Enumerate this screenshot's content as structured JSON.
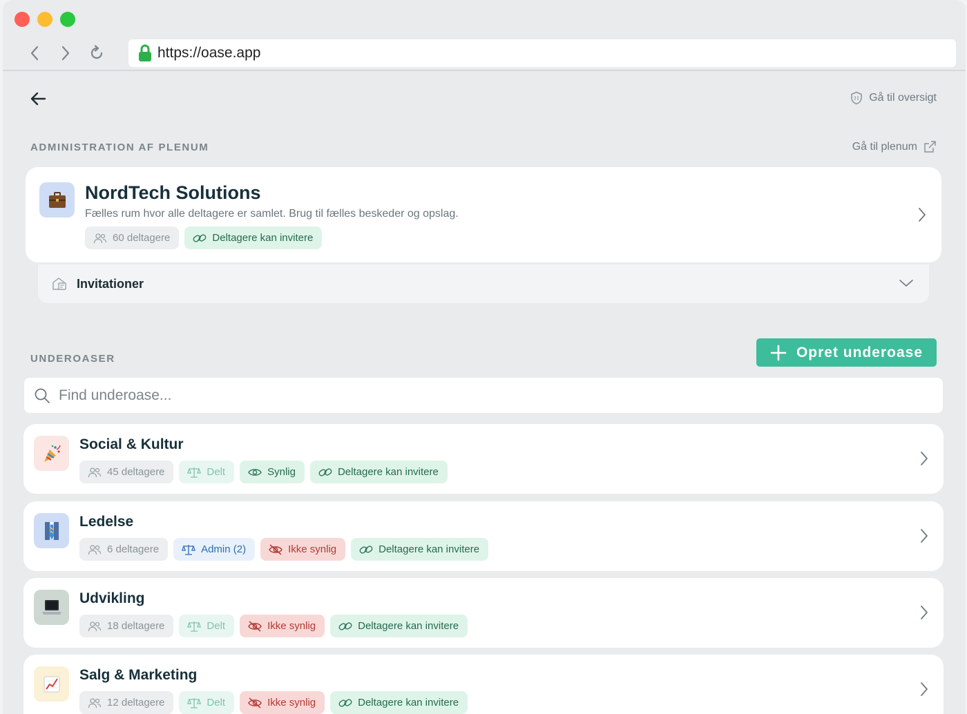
{
  "browser": {
    "url": "https://oase.app"
  },
  "header": {
    "overview_link": "Gå til oversigt"
  },
  "admin": {
    "section_label": "ADMINISTRATION AF PLENUM",
    "plenum_link": "Gå til plenum",
    "org": {
      "name": "NordTech Solutions",
      "description": "Fælles rum hvor alle deltagere er samlet. Brug til fælles beskeder og opslag.",
      "icon": "briefcase",
      "badges": [
        "60 deltagere",
        "Deltagere kan invitere"
      ]
    },
    "invitations_label": "Invitationer"
  },
  "subs": {
    "section_label": "UNDEROASER",
    "create_label": "Opret underoase",
    "search_placeholder": "Find underoase...",
    "items": [
      {
        "name": "Social & Kultur",
        "icon": "party-popper",
        "members": "45 deltagere",
        "role": "Delt",
        "visibility": "Synlig",
        "invite": "Deltagere kan invitere"
      },
      {
        "name": "Ledelse",
        "icon": "necktie",
        "members": "6 deltagere",
        "role": "Admin (2)",
        "visibility": "Ikke synlig",
        "invite": "Deltagere kan invitere"
      },
      {
        "name": "Udvikling",
        "icon": "laptop",
        "members": "18 deltagere",
        "role": "Delt",
        "visibility": "Ikke synlig",
        "invite": "Deltagere kan invitere"
      },
      {
        "name": "Salg & Marketing",
        "icon": "chart-increasing",
        "members": "12 deltagere",
        "role": "Delt",
        "visibility": "Ikke synlig",
        "invite": "Deltagere kan invitere"
      }
    ]
  }
}
